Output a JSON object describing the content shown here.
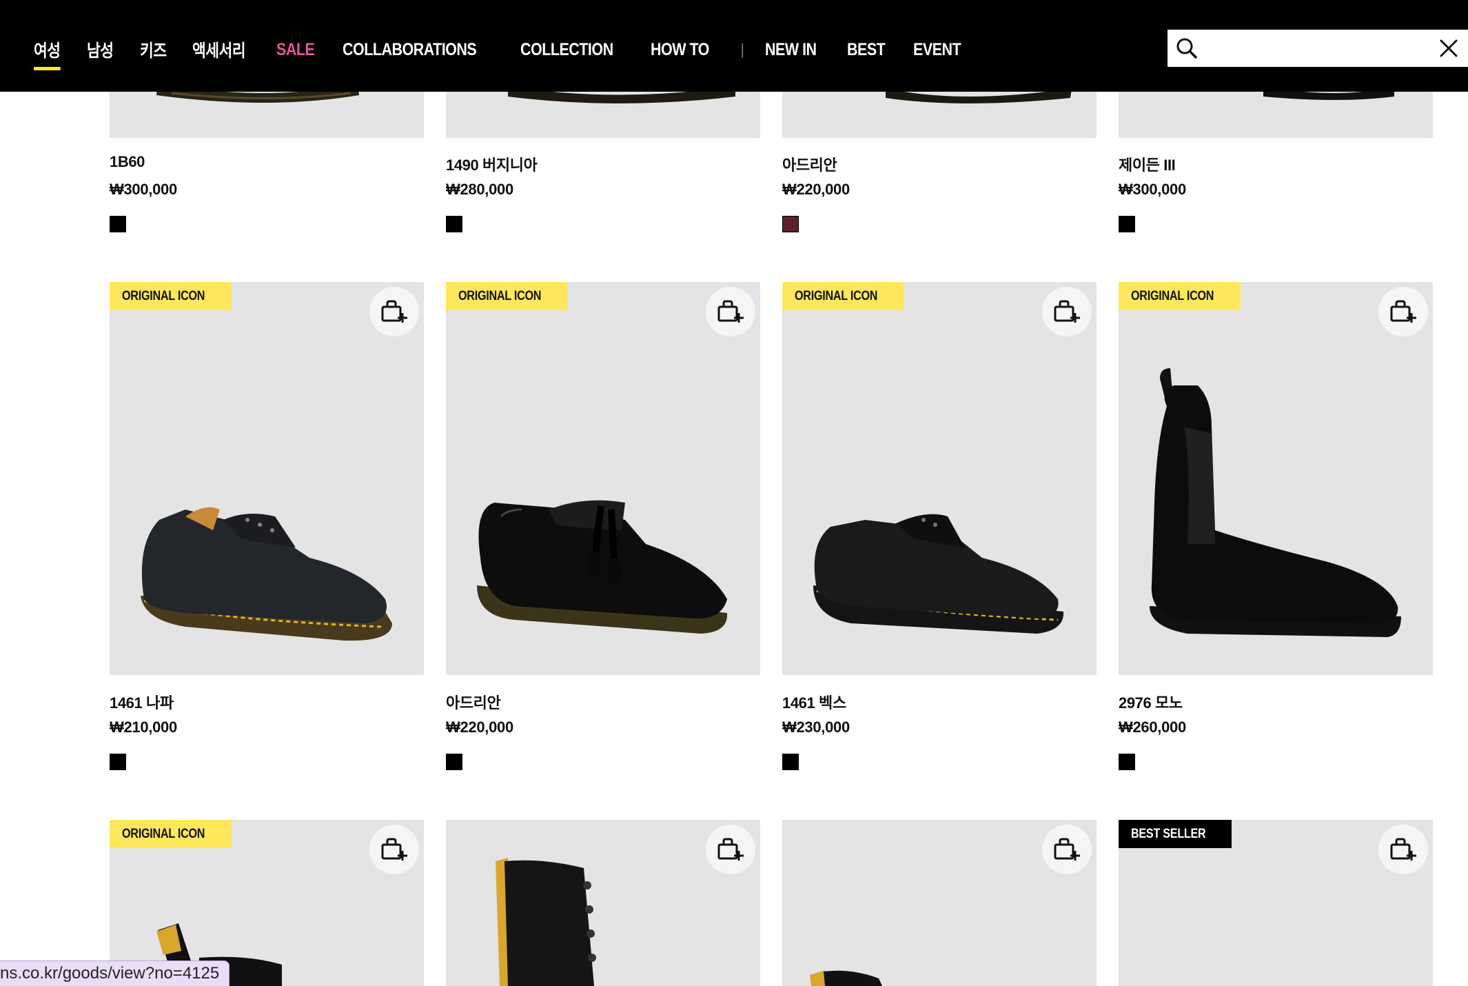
{
  "nav": {
    "items": [
      "여성",
      "남성",
      "키즈",
      "액세서리",
      "SALE",
      "COLLABORATIONS",
      "COLLECTION",
      "HOW TO"
    ],
    "separator": "|",
    "items_right": [
      "NEW IN",
      "BEST",
      "EVENT"
    ]
  },
  "search": {
    "placeholder": "",
    "value": ""
  },
  "colors": {
    "header_bg": "#000000",
    "active_underline": "#ffe33b",
    "sale": "#e0569b",
    "badge_yellow": "#ffe75c",
    "card_bg": "#e4e4e4"
  },
  "row1": [
    {
      "name": "1B60",
      "price": "₩300,000",
      "swatch": "#000000"
    },
    {
      "name": "1490 버지니아",
      "price": "₩280,000",
      "swatch": "#000000"
    },
    {
      "name": "아드리안",
      "price": "₩220,000",
      "swatch": "#5b2328"
    },
    {
      "name": "제이든 III",
      "price": "₩300,000",
      "swatch": "#000000"
    }
  ],
  "row2": [
    {
      "badge": "ORIGINAL ICON",
      "name": "1461 나파",
      "price": "₩210,000",
      "swatch": "#000000"
    },
    {
      "badge": "ORIGINAL ICON",
      "name": "아드리안",
      "price": "₩220,000",
      "swatch": "#000000"
    },
    {
      "badge": "ORIGINAL ICON",
      "name": "1461 벡스",
      "price": "₩230,000",
      "swatch": "#000000"
    },
    {
      "badge": "ORIGINAL ICON",
      "name": "2976 모노",
      "price": "₩260,000",
      "swatch": "#000000"
    }
  ],
  "row3": [
    {
      "badge": "ORIGINAL ICON"
    },
    {
      "badge": ""
    },
    {
      "badge": ""
    },
    {
      "badge": "BEST SELLER"
    }
  ],
  "status_link": "ns.co.kr/goods/view?no=4125"
}
